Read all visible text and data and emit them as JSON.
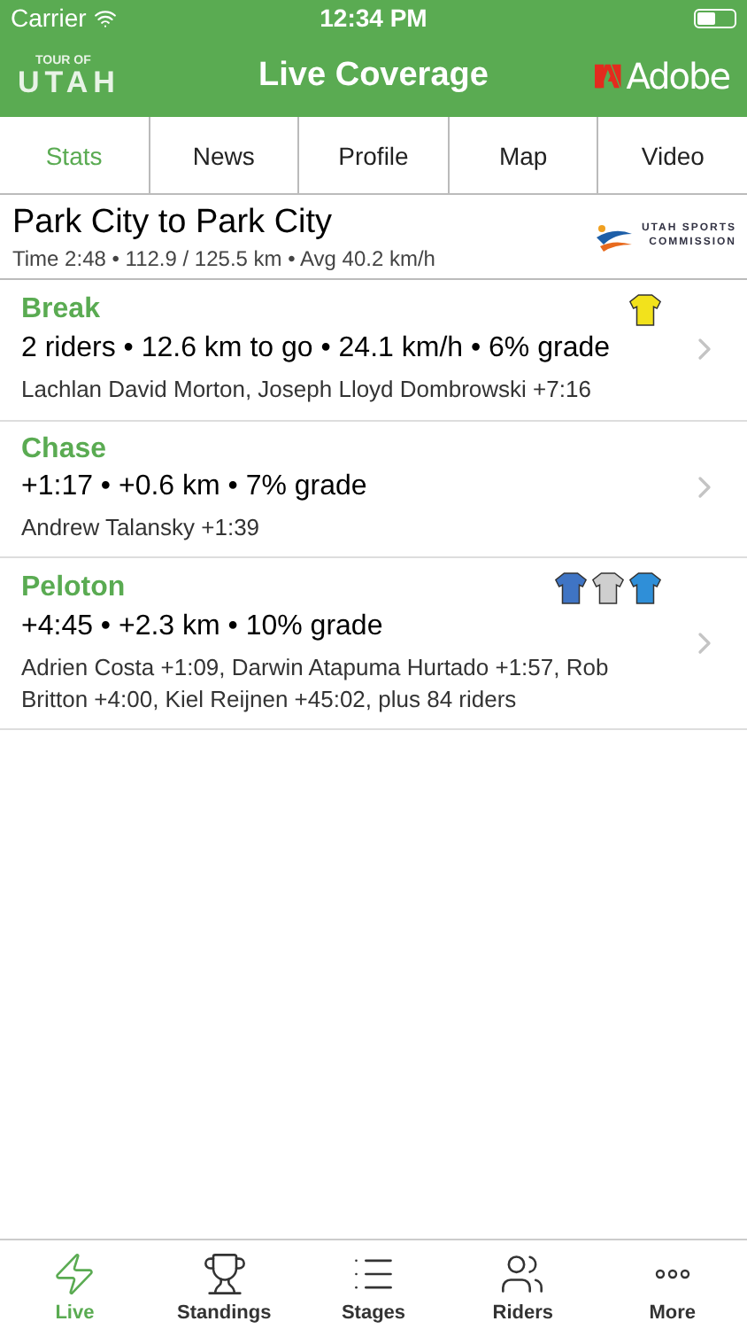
{
  "status_bar": {
    "carrier": "Carrier",
    "time": "12:34 PM"
  },
  "nav_bar": {
    "logo_top": "TOUR OF",
    "logo_bottom": "UTAH",
    "title": "Live Coverage",
    "sponsor": "Adobe"
  },
  "tabs": [
    {
      "label": "Stats",
      "selected": true
    },
    {
      "label": "News",
      "selected": false
    },
    {
      "label": "Profile",
      "selected": false
    },
    {
      "label": "Map",
      "selected": false
    },
    {
      "label": "Video",
      "selected": false
    }
  ],
  "stage": {
    "title": "Park City to Park City",
    "summary": "Time 2:48 • 112.9 / 125.5 km • Avg 40.2 km/h",
    "sponsor_line1": "UTAH SPORTS",
    "sponsor_line2": "COMMISSION"
  },
  "groups": [
    {
      "name": "Break",
      "stats": "2 riders • 12.6 km to go • 24.1 km/h • 6% grade",
      "riders": "Lachlan David Morton, Joseph Lloyd Dombrowski +7:16",
      "jerseys": [
        {
          "color": "#f2e21c"
        }
      ]
    },
    {
      "name": "Chase",
      "stats": "+1:17 • +0.6 km • 7% grade",
      "riders": "Andrew Talansky +1:39"
    },
    {
      "name": "Peloton",
      "stats": "+4:45 • +2.3 km • 10% grade",
      "riders": "Adrien Costa +1:09, Darwin Atapuma Hurtado +1:57, Rob Britton +4:00, Kiel Reijnen +45:02, plus 84 riders",
      "jerseys": [
        {
          "color": "#3f74c4"
        },
        {
          "color": "#cfcfcf"
        },
        {
          "color": "#2f8fd8"
        }
      ]
    }
  ],
  "tab_bar": [
    {
      "kind": "live",
      "label": "Live",
      "selected": true
    },
    {
      "kind": "standings",
      "label": "Standings",
      "selected": false
    },
    {
      "kind": "stages",
      "label": "Stages",
      "selected": false
    },
    {
      "kind": "riders",
      "label": "Riders",
      "selected": false
    },
    {
      "kind": "more",
      "label": "More",
      "selected": false
    }
  ]
}
